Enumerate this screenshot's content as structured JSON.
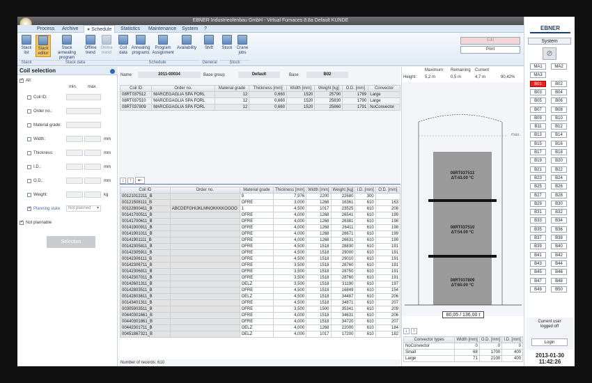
{
  "window": {
    "title": "EBNER Industrieofenbau GmbH - Virtual Furnaces 8.8a Default KUNDE"
  },
  "menu": [
    "Process",
    "Archive",
    "Schedule",
    "Statistics",
    "Maintenance",
    "System",
    "?"
  ],
  "menu_active": "Schedule",
  "ribbon": {
    "buttons": [
      "Stack list",
      "Stack editor",
      "Stack annealing program",
      "Offline trend",
      "Online trend",
      "Coil data",
      "Annealing programs",
      "Program Assignment",
      "Availability",
      "Shift",
      "Stock",
      "Crane jobs"
    ],
    "groups": [
      "Stack",
      "Stack data",
      "Schedule",
      "General",
      "Stock"
    ],
    "edit_label": "Edit",
    "print_label": "Print"
  },
  "coil_selection": {
    "title": "Coil selection",
    "all_label": "All:",
    "min_label": "min.",
    "max_label": "max.",
    "fields": [
      "Coil ID:",
      "Order no.:",
      "Material grade:",
      "Width:",
      "Thickness:",
      "I.D.:",
      "O.D.:",
      "Weight:"
    ],
    "unit_mm": "mm",
    "unit_kg": "kg",
    "planning_state_label": "Planning state",
    "planning_state_value": "Not planned",
    "not_plannable_label": "Not plannable",
    "selection_button": "Selection"
  },
  "stack_info": {
    "name_label": "Name",
    "name_value": "2011-00034",
    "base_group_label": "Base group",
    "base_group_value": "Default",
    "base_label": "Base",
    "base_value": "B02"
  },
  "stack_table": {
    "headers": [
      "Coil ID",
      "Order no.",
      "Material grade",
      "Thickness [mm]",
      "Width [mm]",
      "Weight [kg]",
      "O.D. [mm]",
      "Convector"
    ],
    "rows": [
      [
        "08RT037512",
        "MARCEGAGLIA SPA FORL",
        "12",
        "0,660",
        "1520",
        "25790",
        "1789",
        "Large"
      ],
      [
        "08RT037510",
        "MARCEGAGLIA SPA FORL",
        "12",
        "0,660",
        "1520",
        "25830",
        "1790",
        "Large"
      ],
      [
        "08RT037809",
        "MARCEGAGLIA SPA FORL",
        "12",
        "0,660",
        "1520",
        "25860",
        "1791",
        "NoConvector"
      ]
    ]
  },
  "coil_table": {
    "headers": [
      "Coil ID",
      "Order no.",
      "Material grade",
      "Thickness [mm]",
      "Width [mm]",
      "Weight [kg]",
      "I.D. [mm]",
      "O.D. [mm]"
    ],
    "rows": [
      [
        "00121012211_B",
        "",
        "9",
        "7,976",
        "2200",
        "22680",
        "300",
        ""
      ],
      [
        "00121508111_B",
        "",
        "OFRE",
        "3,000",
        "1268",
        "16361",
        "610",
        "163"
      ],
      [
        "00122800411_B",
        "ABCDEFGHIJKLMNOKKKKOOOO",
        "1",
        "4,500",
        "1017",
        "23525",
        "610",
        "208"
      ],
      [
        "00141700511_B",
        "",
        "OFRE",
        "4,000",
        "1268",
        "26541",
        "610",
        "199"
      ],
      [
        "00141700611_B",
        "",
        "OFRE",
        "4,000",
        "1268",
        "26381",
        "610",
        "198"
      ],
      [
        "00141900911_B",
        "",
        "OFRE",
        "4,000",
        "1268",
        "26411",
        "610",
        "198"
      ],
      [
        "00141901011_B",
        "",
        "OFRE",
        "4,000",
        "1268",
        "26671",
        "610",
        "199"
      ],
      [
        "00141901111_B",
        "",
        "OFRE",
        "4,000",
        "1268",
        "26631",
        "610",
        "199"
      ],
      [
        "00142305811_B",
        "",
        "OFRE",
        "4,500",
        "1518",
        "28830",
        "610",
        "191"
      ],
      [
        "00142305911_B",
        "",
        "OFRE",
        "4,500",
        "1518",
        "29000",
        "610",
        "191"
      ],
      [
        "00142306111_B",
        "",
        "OFRE",
        "4,500",
        "1518",
        "29010",
        "610",
        "191"
      ],
      [
        "00142306711_B",
        "",
        "OFRE",
        "3,500",
        "1518",
        "28760",
        "610",
        "191"
      ],
      [
        "00142306811_B",
        "",
        "OFRE",
        "3,500",
        "1518",
        "28750",
        "610",
        "191"
      ],
      [
        "00142307011_B",
        "",
        "OFRE",
        "3,500",
        "1518",
        "28760",
        "610",
        "191"
      ],
      [
        "00142601311_B",
        "",
        "OELZ",
        "3,500",
        "1518",
        "31190",
        "610",
        "197"
      ],
      [
        "00142803511_B",
        "",
        "OFRE",
        "4,500",
        "1518",
        "16849",
        "610",
        "154"
      ],
      [
        "00142803611_B",
        "",
        "OELZ",
        "4,500",
        "1518",
        "34487",
        "610",
        "206"
      ],
      [
        "00143401311_B",
        "",
        "OFRE",
        "4,500",
        "1518",
        "34871",
        "610",
        "207"
      ],
      [
        "00305903511_B",
        "",
        "OFRE",
        "3,500",
        "1500",
        "35341",
        "610",
        "209"
      ],
      [
        "00440301661_B",
        "",
        "OFRE",
        "4,000",
        "1518",
        "34631",
        "610",
        "206"
      ],
      [
        "00440301861_B",
        "",
        "OFRE",
        "4,000",
        "1518",
        "34720",
        "610",
        "207"
      ],
      [
        "00442301711_B",
        "",
        "OELZ",
        "4,000",
        "1268",
        "22000",
        "610",
        "184"
      ],
      [
        "00451867321_B",
        "",
        "OELZ",
        "4,000",
        "1017",
        "17200",
        "610",
        "182"
      ]
    ],
    "record_count": "Number of records: 610"
  },
  "furnace": {
    "stats_headers": [
      "Maximum",
      "Remaining",
      "Current"
    ],
    "height_label": "Height:",
    "height_values": [
      "5,2 m",
      "0,5 m",
      "4,7 m",
      "90,42%"
    ],
    "max_label": "max.",
    "coils": [
      {
        "id": "08RT037512",
        "temp": "ΔT:43.00 °C"
      },
      {
        "id": "08RT037510",
        "temp": "ΔT:54.00 °C"
      },
      {
        "id": "08RT037809",
        "temp": "ΔT:60.00 °C"
      }
    ],
    "base_readout": "80,05 / 136,00 t"
  },
  "convector_table": {
    "headers": [
      "Convector types",
      "Width [mm]",
      "O.D. [mm]",
      "I.D. [mm]"
    ],
    "rows": [
      [
        "NoConvector",
        "0",
        "0",
        "0"
      ],
      [
        "Small",
        "68",
        "1700",
        "400"
      ],
      [
        "Large",
        "71",
        "2100",
        "400"
      ]
    ]
  },
  "sidebar": {
    "logo": "EBNER",
    "system_label": "System",
    "bases": [
      "MA1",
      "MA2",
      "MA3",
      "",
      "B01",
      "B02",
      "B03",
      "B04",
      "B05",
      "B06",
      "B07",
      "B08",
      "B09",
      "B10",
      "B11",
      "B12",
      "B13",
      "B14",
      "B15",
      "B16",
      "B17",
      "B18",
      "B19",
      "B20",
      "B21",
      "B22",
      "B23",
      "B24",
      "B25",
      "B26",
      "B27",
      "B28",
      "B29",
      "B30",
      "B31",
      "B32",
      "B33",
      "B34",
      "B35",
      "B36",
      "B37",
      "B38",
      "B39",
      "B40",
      "B41",
      "B42",
      "B43",
      "B44",
      "B45",
      "B46",
      "B47",
      "B48",
      "B49",
      "B50"
    ],
    "selected_base": "B01",
    "user_status": "Current user logged off",
    "login_label": "Login",
    "date": "2013-01-30",
    "time": "11:42:26"
  },
  "colors": {
    "accent": "#1d3d6a",
    "selected_base": "#e22222",
    "ribbon_selected": "#f7c25a"
  }
}
